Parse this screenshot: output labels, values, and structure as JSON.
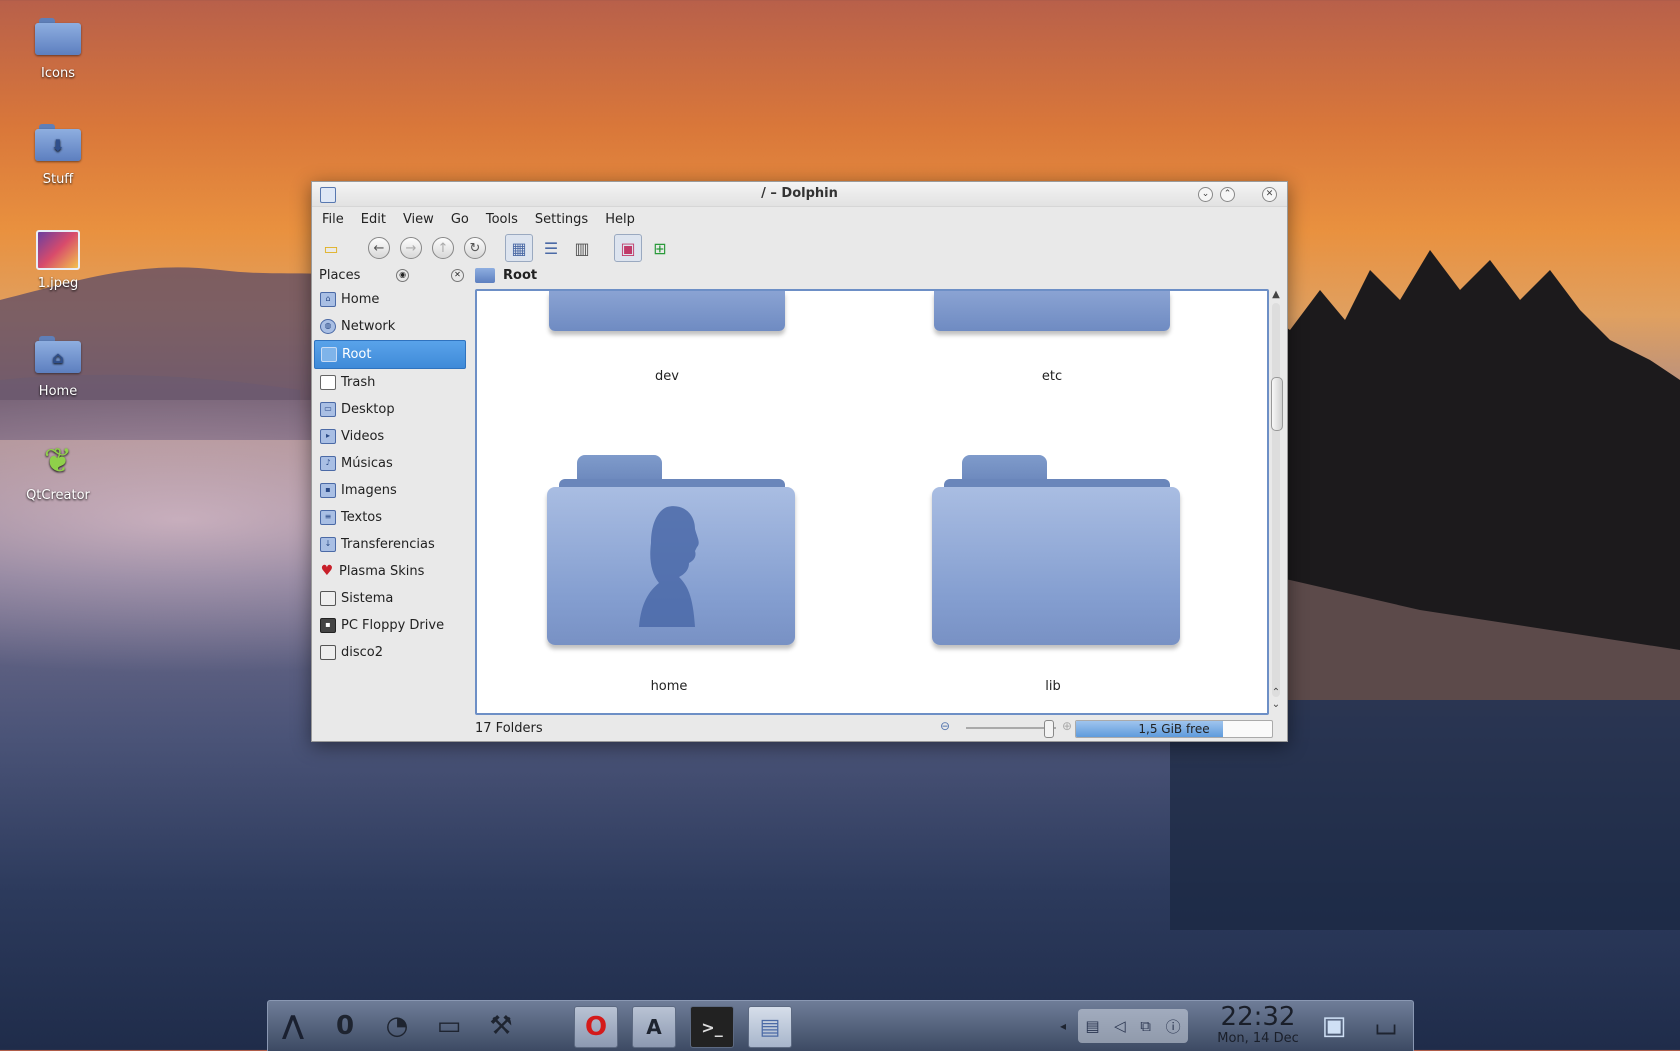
{
  "desktop": {
    "icons": [
      {
        "label": "Icons",
        "icon": "folder-icon"
      },
      {
        "label": "Stuff",
        "icon": "download-folder-icon"
      },
      {
        "label": "1.jpeg",
        "icon": "image-file-icon"
      },
      {
        "label": "Home",
        "icon": "home-folder-icon"
      },
      {
        "label": "QtCreator",
        "icon": "qtcreator-icon"
      }
    ]
  },
  "window": {
    "title": "/ – Dolphin",
    "menu": [
      "File",
      "Edit",
      "View",
      "Go",
      "Tools",
      "Settings",
      "Help"
    ],
    "toolbar": [
      "new-folder-icon",
      "back-icon",
      "forward-icon",
      "up-icon",
      "reload-icon",
      "icons-view-icon",
      "details-view-icon",
      "columns-view-icon",
      "preview-icon",
      "split-icon"
    ]
  },
  "places": {
    "title": "Places",
    "items": [
      {
        "label": "Home",
        "icon": "home-icon"
      },
      {
        "label": "Network",
        "icon": "network-icon"
      },
      {
        "label": "Root",
        "icon": "folder-icon",
        "selected": true
      },
      {
        "label": "Trash",
        "icon": "trash-icon"
      },
      {
        "label": "Desktop",
        "icon": "desktop-folder-icon"
      },
      {
        "label": "Videos",
        "icon": "videos-folder-icon"
      },
      {
        "label": "Músicas",
        "icon": "music-folder-icon"
      },
      {
        "label": "Imagens",
        "icon": "pictures-folder-icon"
      },
      {
        "label": "Textos",
        "icon": "documents-folder-icon"
      },
      {
        "label": "Transferencias",
        "icon": "downloads-folder-icon"
      },
      {
        "label": "Plasma Skins",
        "icon": "heart-icon"
      },
      {
        "label": "Sistema",
        "icon": "drive-icon"
      },
      {
        "label": "PC Floppy Drive",
        "icon": "floppy-icon"
      },
      {
        "label": "disco2",
        "icon": "drive-icon"
      }
    ]
  },
  "location": {
    "crumb": "Root"
  },
  "folders": [
    {
      "name": "dev"
    },
    {
      "name": "etc"
    },
    {
      "name": "home"
    },
    {
      "name": "lib"
    }
  ],
  "status": {
    "count": "17 Folders",
    "free_space": "1,5 GiB free",
    "used_fraction": 0.75
  },
  "taskbar": {
    "time": "22:32",
    "date": "Mon, 14 Dec"
  },
  "colors": {
    "selection": "#3f8ad8",
    "folder": "#849ed0"
  }
}
